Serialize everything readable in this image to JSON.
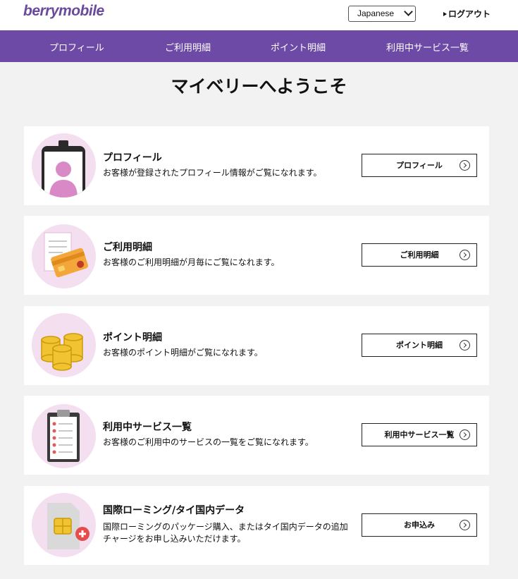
{
  "header": {
    "logo": "berrymobile",
    "language": "Japanese",
    "logout": "ログアウト"
  },
  "nav": {
    "items": [
      "プロフィール",
      "ご利用明細",
      "ポイント明細",
      "利用中サービス一覧"
    ]
  },
  "main": {
    "title": "マイベリーへようこそ",
    "cards": [
      {
        "heading": "プロフィール",
        "description": "お客様が登録されたプロフィール情報がご覧になれます。",
        "button": "プロフィール",
        "icon": "profile-phone-icon"
      },
      {
        "heading": "ご利用明細",
        "description": "お客様のご利用明細が月毎にご覧になれます。",
        "button": "ご利用明細",
        "icon": "receipt-card-icon"
      },
      {
        "heading": "ポイント明細",
        "description": "お客様のポイント明細がご覧になれます。",
        "button": "ポイント明細",
        "icon": "gold-coins-icon"
      },
      {
        "heading": "利用中サービス一覧",
        "description": "お客様のご利用中のサービスの一覧をご覧になれます。",
        "button": "利用中サービス一覧",
        "icon": "clipboard-checklist-icon"
      },
      {
        "heading": "国際ローミング/タイ国内データ",
        "description_line1": "国際ローミングのパッケージ購入、またはタイ国内データの追加",
        "description_line2": "チャージをお申し込みいただけます。",
        "button": "お申込み",
        "icon": "sim-card-add-icon"
      }
    ]
  },
  "colors": {
    "nav_background": "#6d4aa5",
    "logo": "#6a4a9c",
    "icon_circle": "#f3dff0"
  }
}
